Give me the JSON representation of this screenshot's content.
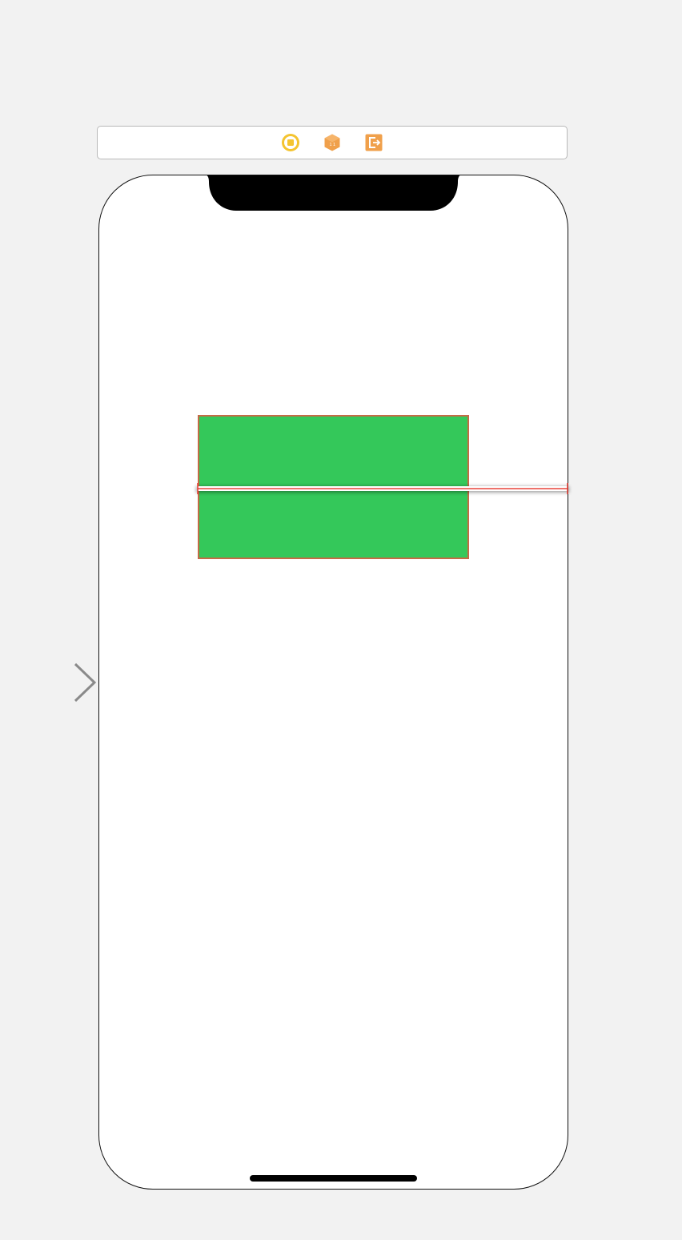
{
  "scene_dock": {
    "icons": [
      {
        "name": "view-controller-icon",
        "color": "#f4c430"
      },
      {
        "name": "first-responder-icon",
        "color": "#f0a04b"
      },
      {
        "name": "exit-icon",
        "color": "#f0a04b"
      }
    ]
  },
  "device": {
    "model": "iPhone X",
    "background": "#ffffff"
  },
  "green_view": {
    "color": "#34c85a",
    "selected_outline": "#c56b46"
  },
  "constraint": {
    "color": "#e8443a"
  }
}
